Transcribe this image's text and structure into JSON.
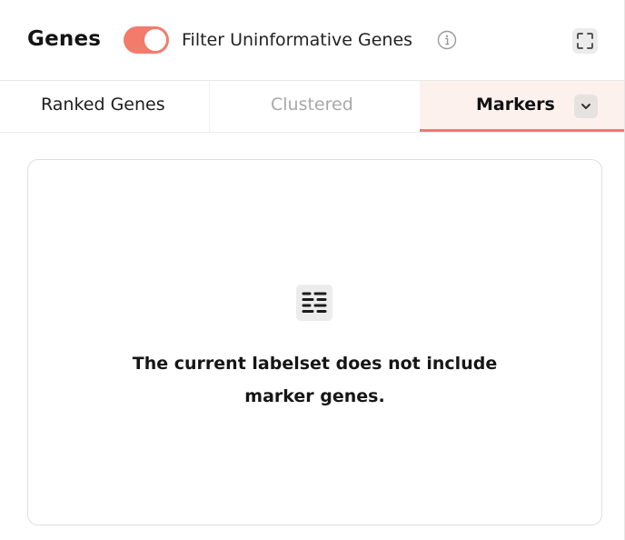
{
  "header": {
    "title": "Genes",
    "filter_toggle": {
      "label": "Filter Uninformative Genes",
      "on": true
    },
    "accent_color": "#f27b6b"
  },
  "tabs": [
    {
      "label": "Ranked Genes",
      "state": "enabled"
    },
    {
      "label": "Clustered",
      "state": "disabled"
    },
    {
      "label": "Markers",
      "state": "active"
    }
  ],
  "icons": {
    "info": "info-circle-icon",
    "fullscreen": "fullscreen-expand-icon",
    "dropdown": "chevron-down-icon",
    "empty": "list-lines-icon"
  },
  "empty_state": {
    "line1": "The current labelset does not include",
    "line2": "marker genes."
  }
}
